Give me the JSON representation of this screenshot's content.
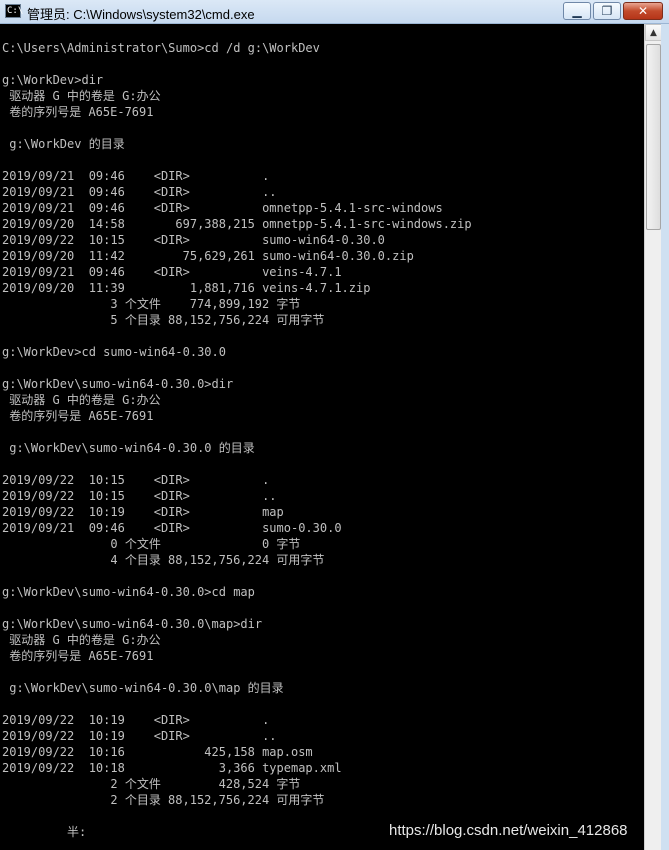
{
  "window": {
    "title": "管理员: C:\\Windows\\system32\\cmd.exe",
    "icon_text": "C:\\",
    "controls": {
      "minimize": "▁",
      "maximize": "❐",
      "close": "✕"
    }
  },
  "console": {
    "lines": [
      "C:\\Users\\Administrator\\Sumo>cd /d g:\\WorkDev",
      "",
      "g:\\WorkDev>dir",
      " 驱动器 G 中的卷是 G:办公",
      " 卷的序列号是 A65E-7691",
      "",
      " g:\\WorkDev 的目录",
      "",
      "2019/09/21  09:46    <DIR>          .",
      "2019/09/21  09:46    <DIR>          ..",
      "2019/09/21  09:46    <DIR>          omnetpp-5.4.1-src-windows",
      "2019/09/20  14:58       697,388,215 omnetpp-5.4.1-src-windows.zip",
      "2019/09/22  10:15    <DIR>          sumo-win64-0.30.0",
      "2019/09/20  11:42        75,629,261 sumo-win64-0.30.0.zip",
      "2019/09/21  09:46    <DIR>          veins-4.7.1",
      "2019/09/20  11:39         1,881,716 veins-4.7.1.zip",
      "               3 个文件    774,899,192 字节",
      "               5 个目录 88,152,756,224 可用字节",
      "",
      "g:\\WorkDev>cd sumo-win64-0.30.0",
      "",
      "g:\\WorkDev\\sumo-win64-0.30.0>dir",
      " 驱动器 G 中的卷是 G:办公",
      " 卷的序列号是 A65E-7691",
      "",
      " g:\\WorkDev\\sumo-win64-0.30.0 的目录",
      "",
      "2019/09/22  10:15    <DIR>          .",
      "2019/09/22  10:15    <DIR>          ..",
      "2019/09/22  10:19    <DIR>          map",
      "2019/09/21  09:46    <DIR>          sumo-0.30.0",
      "               0 个文件              0 字节",
      "               4 个目录 88,152,756,224 可用字节",
      "",
      "g:\\WorkDev\\sumo-win64-0.30.0>cd map",
      "",
      "g:\\WorkDev\\sumo-win64-0.30.0\\map>dir",
      " 驱动器 G 中的卷是 G:办公",
      " 卷的序列号是 A65E-7691",
      "",
      " g:\\WorkDev\\sumo-win64-0.30.0\\map 的目录",
      "",
      "2019/09/22  10:19    <DIR>          .",
      "2019/09/22  10:19    <DIR>          ..",
      "2019/09/22  10:16           425,158 map.osm",
      "2019/09/22  10:18             3,366 typemap.xml",
      "               2 个文件        428,524 字节",
      "               2 个目录 88,152,756,224 可用字节",
      "",
      "         半:"
    ]
  },
  "scrollbar": {
    "up_arrow": "▲"
  },
  "watermark": "https://blog.csdn.net/weixin_412868",
  "colors": {
    "console_bg": "#000000",
    "console_text": "#c0c0c0",
    "close_button": "#c34a2b"
  }
}
